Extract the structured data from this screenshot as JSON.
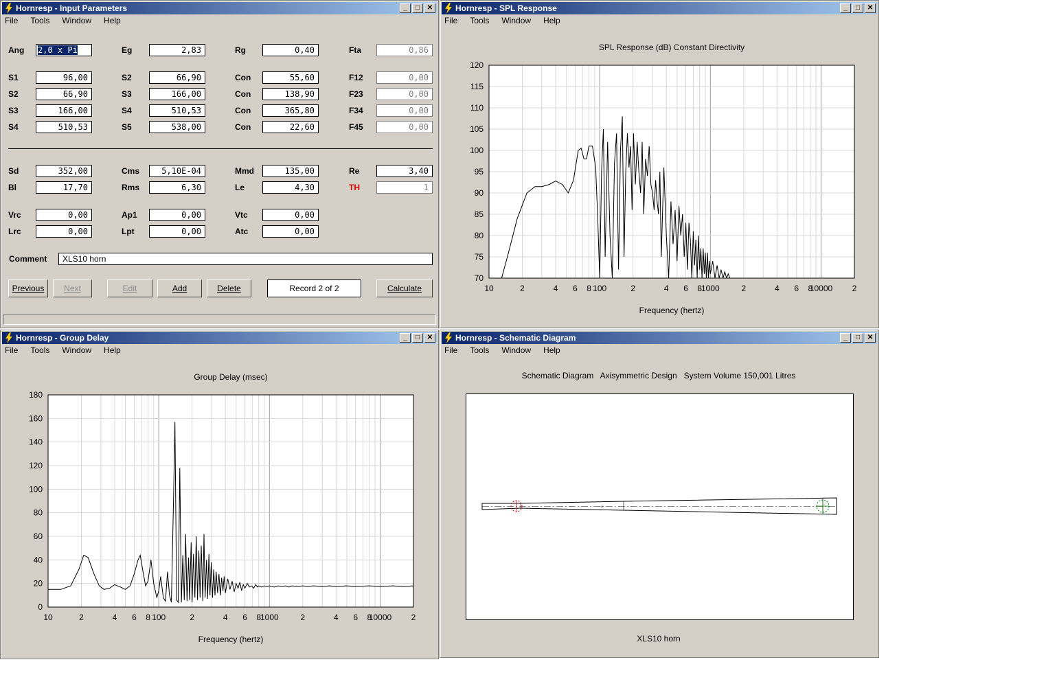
{
  "windows": {
    "input": {
      "title": "Hornresp - Input Parameters",
      "menu": [
        "File",
        "Tools",
        "Window",
        "Help"
      ],
      "row_ang": [
        {
          "label": "Ang",
          "value": "2,0 x Pi",
          "selected": true
        },
        {
          "label": "Eg",
          "value": "2,83"
        },
        {
          "label": "Rg",
          "value": "0,40"
        },
        {
          "label": "Fta",
          "value": "0,86",
          "disabled": true
        }
      ],
      "rows_s": [
        [
          {
            "label": "S1",
            "value": "96,00"
          },
          {
            "label": "S2",
            "value": "66,90"
          },
          {
            "label": "Con",
            "value": "55,60"
          },
          {
            "label": "F12",
            "value": "0,00",
            "disabled": true
          }
        ],
        [
          {
            "label": "S2",
            "value": "66,90"
          },
          {
            "label": "S3",
            "value": "166,00"
          },
          {
            "label": "Con",
            "value": "138,90"
          },
          {
            "label": "F23",
            "value": "0,00",
            "disabled": true
          }
        ],
        [
          {
            "label": "S3",
            "value": "166,00"
          },
          {
            "label": "S4",
            "value": "510,53"
          },
          {
            "label": "Con",
            "value": "365,80"
          },
          {
            "label": "F34",
            "value": "0,00",
            "disabled": true
          }
        ],
        [
          {
            "label": "S4",
            "value": "510,53"
          },
          {
            "label": "S5",
            "value": "538,00"
          },
          {
            "label": "Con",
            "value": "22,60"
          },
          {
            "label": "F45",
            "value": "0,00",
            "disabled": true
          }
        ]
      ],
      "rows_driver": [
        [
          {
            "label": "Sd",
            "value": "352,00"
          },
          {
            "label": "Cms",
            "value": "5,10E-04"
          },
          {
            "label": "Mmd",
            "value": "135,00"
          },
          {
            "label": "Re",
            "value": "3,40"
          }
        ],
        [
          {
            "label": "Bl",
            "value": "17,70"
          },
          {
            "label": "Rms",
            "value": "6,30"
          },
          {
            "label": "Le",
            "value": "4,30"
          },
          {
            "label": "TH",
            "value": "1",
            "disabled": true,
            "red": true
          }
        ]
      ],
      "rows_chamber": [
        [
          {
            "label": "Vrc",
            "value": "0,00"
          },
          {
            "label": "Ap1",
            "value": "0,00"
          },
          {
            "label": "Vtc",
            "value": "0,00"
          }
        ],
        [
          {
            "label": "Lrc",
            "value": "0,00"
          },
          {
            "label": "Lpt",
            "value": "0,00"
          },
          {
            "label": "Atc",
            "value": "0,00"
          }
        ]
      ],
      "comment_label": "Comment",
      "comment_value": "XLS10 horn",
      "buttons": {
        "previous": "Previous",
        "next": "Next",
        "edit": "Edit",
        "add": "Add",
        "delete": "Delete",
        "calculate": "Calculate"
      },
      "record": "Record 2 of 2"
    },
    "spl": {
      "title": "Hornresp - SPL Response",
      "menu": [
        "File",
        "Tools",
        "Window",
        "Help"
      ]
    },
    "gd": {
      "title": "Hornresp - Group Delay",
      "menu": [
        "File",
        "Tools",
        "Window",
        "Help"
      ]
    },
    "schematic": {
      "title": "Hornresp - Schematic Diagram",
      "menu": [
        "File",
        "Tools",
        "Window",
        "Help"
      ],
      "heading": "Schematic Diagram   Axisymmetric Design   System Volume 150,001 Litres",
      "footer": "XLS10 horn"
    }
  },
  "chart_data": [
    {
      "type": "line",
      "title": "SPL Response (dB)   Constant Directivity",
      "xlabel": "Frequency (hertz)",
      "ylabel": "",
      "xscale": "log",
      "xlim": [
        10,
        20000
      ],
      "ylim": [
        70,
        120
      ],
      "yticks": [
        70,
        75,
        80,
        85,
        90,
        95,
        100,
        105,
        110,
        115,
        120
      ],
      "xtick_labels": [
        "10",
        "2",
        "4",
        "6",
        "8",
        "100",
        "2",
        "4",
        "6",
        "8",
        "1000",
        "2",
        "4",
        "6",
        "8",
        "10000",
        "2"
      ],
      "grid": true,
      "series": [
        {
          "x": [
            13,
            15,
            18,
            22,
            26,
            30,
            35,
            40,
            46,
            52,
            58,
            64,
            68,
            72,
            76,
            80,
            86,
            92,
            96,
            100,
            104,
            108,
            112,
            118,
            124,
            130,
            136,
            142,
            148,
            154,
            160,
            166,
            172,
            178,
            184,
            190,
            196,
            202,
            210,
            218,
            226,
            234,
            242,
            250,
            260,
            270,
            280,
            290,
            300,
            310,
            320,
            330,
            340,
            350,
            360,
            380,
            400,
            420,
            440,
            460,
            480,
            500,
            520,
            540,
            560,
            580,
            600,
            620,
            640,
            660,
            680,
            700,
            720,
            740,
            760,
            780,
            800,
            820,
            840,
            860,
            880,
            900,
            920,
            940,
            960,
            980,
            1000,
            1050,
            1100,
            1150,
            1200,
            1250,
            1300,
            1350,
            1400,
            1450,
            1500
          ],
          "y": [
            70,
            76,
            84,
            90,
            91.5,
            91.5,
            92,
            92.8,
            92,
            90,
            93,
            100,
            100.5,
            98,
            98,
            101,
            101,
            96,
            84,
            70,
            95,
            105,
            75,
            102,
            80,
            70,
            97,
            104,
            72,
            100,
            108,
            75,
            95,
            104,
            96,
            101,
            86,
            104,
            92,
            102,
            95,
            90,
            102,
            85,
            98,
            94,
            101,
            92,
            90,
            86,
            93,
            88,
            85,
            95,
            75,
            96,
            80,
            70,
            88,
            78,
            86,
            74,
            87,
            80,
            85,
            75,
            83,
            72,
            83,
            79,
            70,
            81,
            73,
            79,
            70,
            80,
            72,
            77,
            70,
            77,
            71,
            76,
            70,
            76,
            70,
            74,
            71,
            74,
            70,
            73,
            70,
            72,
            70,
            71.5,
            70,
            71,
            70
          ]
        }
      ]
    },
    {
      "type": "line",
      "title": "Group Delay (msec)",
      "xlabel": "Frequency (hertz)",
      "ylabel": "",
      "xscale": "log",
      "xlim": [
        10,
        20000
      ],
      "ylim": [
        0,
        180
      ],
      "yticks": [
        0,
        20,
        40,
        60,
        80,
        100,
        120,
        140,
        160,
        180
      ],
      "xtick_labels": [
        "10",
        "2",
        "4",
        "6",
        "8",
        "100",
        "2",
        "4",
        "6",
        "8",
        "1000",
        "2",
        "4",
        "6",
        "8",
        "10000",
        "2"
      ],
      "grid": true,
      "series": [
        {
          "x": [
            10,
            13,
            16,
            19,
            21,
            23,
            26,
            29,
            32,
            36,
            40,
            45,
            50,
            55,
            60,
            65,
            68,
            72,
            76,
            80,
            85,
            90,
            96,
            100,
            104,
            110,
            115,
            120,
            125,
            130,
            136,
            140,
            145,
            150,
            155,
            160,
            165,
            170,
            175,
            180,
            186,
            190,
            196,
            200,
            206,
            212,
            218,
            224,
            230,
            236,
            242,
            250,
            256,
            262,
            270,
            276,
            284,
            290,
            298,
            306,
            314,
            322,
            330,
            340,
            350,
            360,
            370,
            380,
            390,
            400,
            420,
            440,
            460,
            480,
            500,
            520,
            540,
            560,
            580,
            600,
            630,
            660,
            690,
            720,
            750,
            780,
            800,
            850,
            900,
            950,
            1000,
            1100,
            1200,
            1300,
            1400,
            1500,
            1600,
            1800,
            2000,
            2200,
            2500,
            3000,
            3500,
            4000,
            5000,
            6000,
            8000,
            10000,
            13000,
            16000,
            20000
          ],
          "y": [
            15,
            15,
            18,
            32,
            44,
            42,
            28,
            18,
            15,
            16,
            19,
            17,
            15,
            18,
            28,
            40,
            44,
            30,
            18,
            22,
            40,
            20,
            8,
            14,
            26,
            8,
            5,
            30,
            10,
            4,
            92,
            157,
            6,
            4,
            118,
            4,
            44,
            6,
            62,
            5,
            42,
            6,
            55,
            4,
            45,
            8,
            60,
            6,
            48,
            8,
            52,
            5,
            62,
            8,
            40,
            7,
            45,
            10,
            38,
            8,
            32,
            10,
            30,
            12,
            28,
            10,
            25,
            14,
            26,
            12,
            24,
            15,
            22,
            13,
            20,
            16,
            21,
            14,
            19,
            16,
            20,
            17,
            18,
            16,
            19,
            17,
            18,
            17,
            18,
            17.5,
            18,
            17,
            18,
            17.5,
            18,
            17,
            18,
            17.5,
            18,
            17.5,
            18,
            17.5,
            18,
            17.5,
            18,
            17.5,
            18,
            17.5,
            18,
            17.5,
            18
          ]
        }
      ]
    }
  ]
}
